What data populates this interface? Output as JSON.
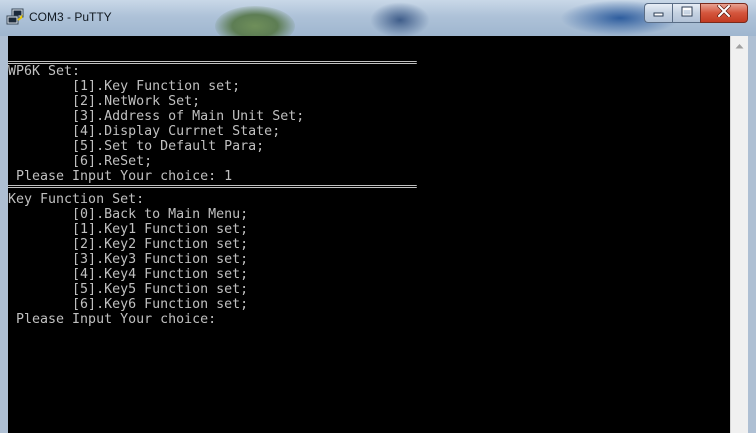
{
  "window": {
    "title": "COM3 - PuTTY"
  },
  "terminal": {
    "lines": [
      "WP6K Set:",
      "        [1].Key Function set;",
      "        [2].NetWork Set;",
      "        [3].Address of Main Unit Set;",
      "        [4].Display Currnet State;",
      "        [5].Set to Default Para;",
      "        [6].ReSet;",
      " Please Input Your choice: 1",
      "Key Function Set:",
      "        [0].Back to Main Menu;",
      "        [1].Key1 Function set;",
      "        [2].Key2 Function set;",
      "        [3].Key3 Function set;",
      "        [4].Key4 Function set;",
      "        [5].Key5 Function set;",
      "        [6].Key6 Function set;",
      " Please Input Your choice:"
    ]
  },
  "icons": {
    "app": "putty-icon",
    "minimize": "minimize-icon",
    "maximize": "maximize-icon",
    "close": "close-icon",
    "scroll_up": "scroll-up-arrow-icon"
  },
  "colors": {
    "terminal_bg": "#000000",
    "terminal_fg": "#c0c0c0",
    "close_button": "#c9432a"
  }
}
